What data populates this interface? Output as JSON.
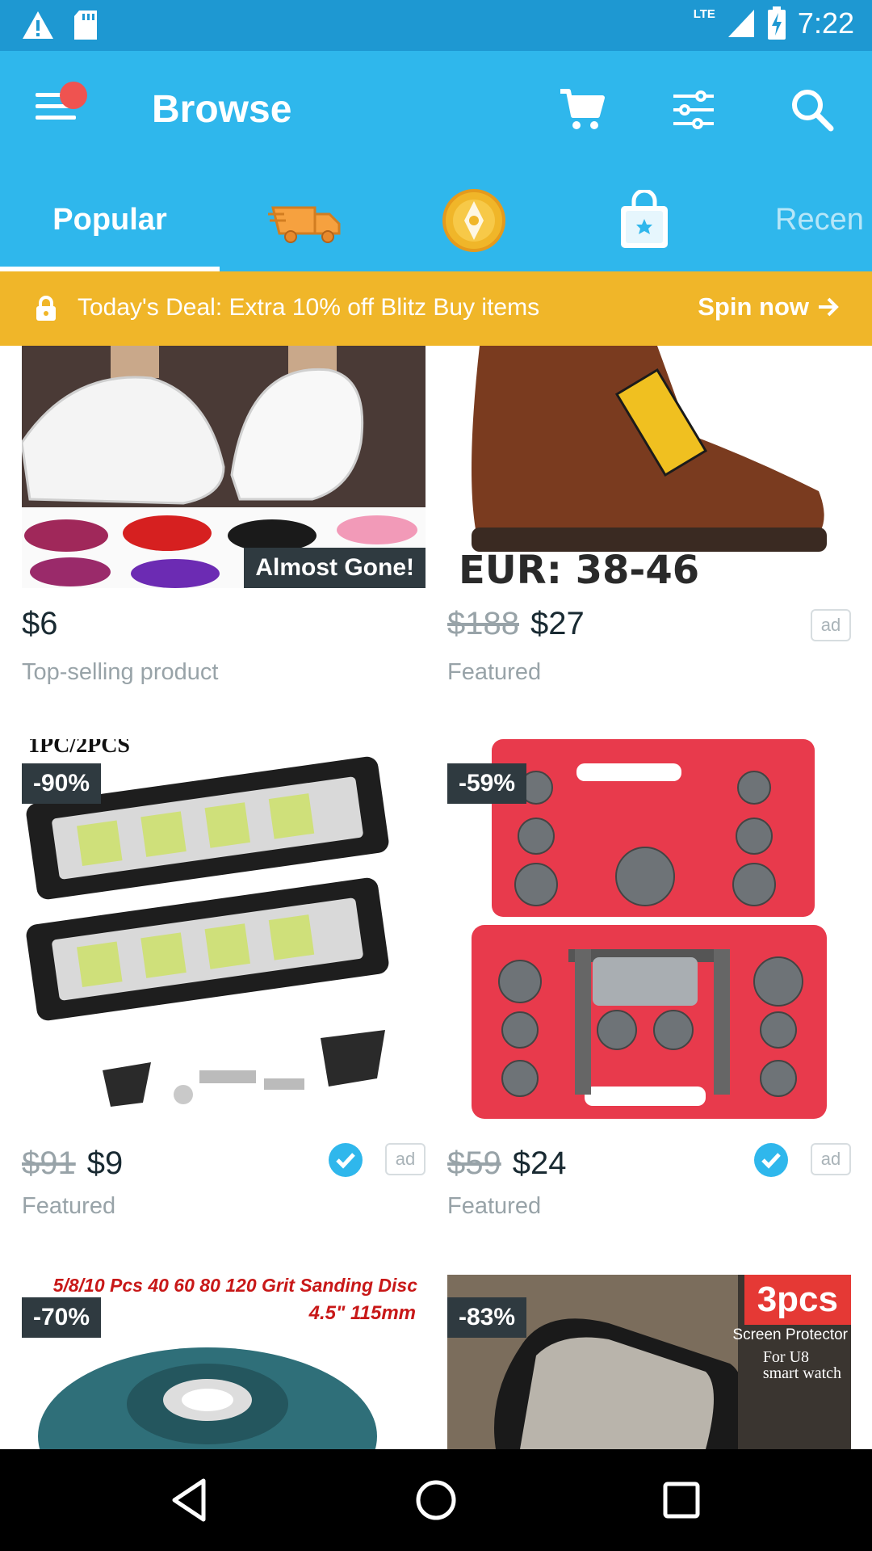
{
  "status_bar": {
    "time": "7:22",
    "network": "LTE"
  },
  "app_bar": {
    "title": "Browse"
  },
  "tabs": {
    "popular": "Popular",
    "recent": "Recen"
  },
  "deal_banner": {
    "text": "Today's Deal: Extra 10% off Blitz Buy items",
    "action": "Spin now"
  },
  "products": [
    {
      "price": "$6",
      "old_price": "",
      "subtitle": "Top-selling product",
      "badge": "Almost Gone!",
      "ad": "",
      "image_text": ""
    },
    {
      "price": "$27",
      "old_price": "$188",
      "subtitle": "Featured",
      "badge": "",
      "ad": "ad",
      "image_text": "EUR: 38-46"
    },
    {
      "price": "$9",
      "old_price": "$91",
      "subtitle": "Featured",
      "badge": "-90%",
      "ad": "ad",
      "image_text": "1PC/2PCS"
    },
    {
      "price": "$24",
      "old_price": "$59",
      "subtitle": "Featured",
      "badge": "-59%",
      "ad": "ad",
      "image_text": ""
    },
    {
      "price": "",
      "old_price": "",
      "subtitle": "",
      "badge": "-70%",
      "ad": "",
      "image_text": "5/8/10 Pcs 40 60 80 120 Grit Sanding Disc",
      "image_text2": "4.5\" 115mm"
    },
    {
      "price": "",
      "old_price": "",
      "subtitle": "",
      "badge": "-83%",
      "ad": "",
      "image_text": "3pcs",
      "image_text2": "Screen Protector",
      "image_text3": "For U8",
      "image_text4": "smart watch"
    }
  ]
}
